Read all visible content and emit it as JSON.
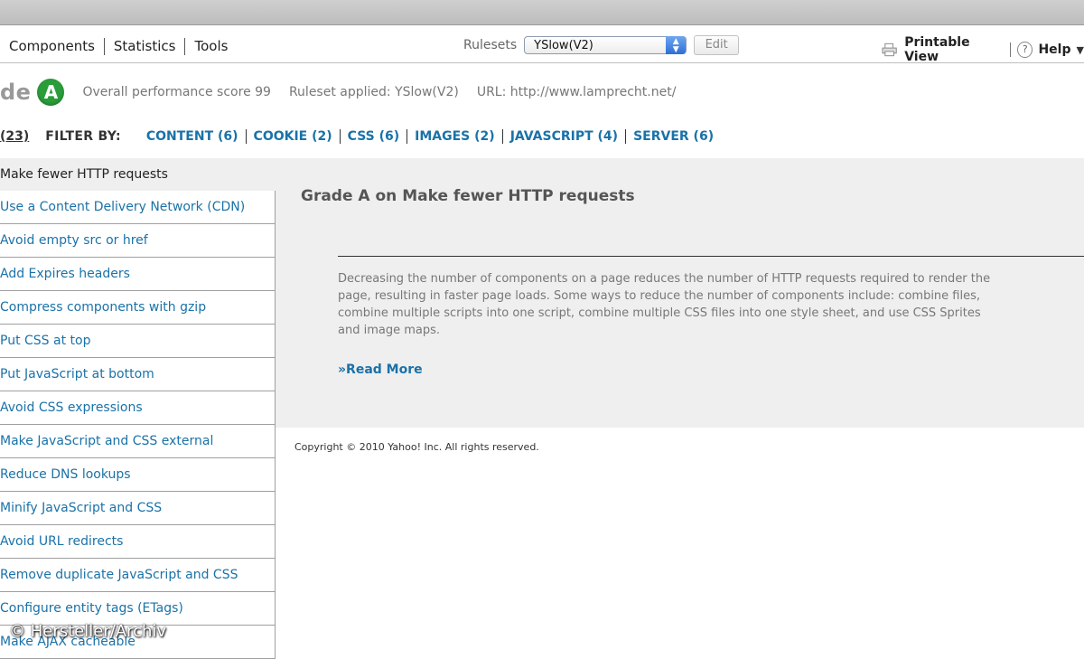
{
  "nav": {
    "tabs": [
      "Components",
      "Statistics",
      "Tools"
    ],
    "rulesets_label": "Rulesets",
    "ruleset_selected": "YSlow(V2)",
    "edit_label": "Edit",
    "printable_view": "Printable View",
    "help": "Help"
  },
  "grade": {
    "word": "de",
    "letter": "A",
    "score_text": "Overall performance score 99",
    "ruleset_text": "Ruleset applied: YSlow(V2)",
    "url_text": "URL: http://www.lamprecht.net/"
  },
  "filter": {
    "count": "(23)",
    "label": "FILTER BY:",
    "links": [
      "CONTENT (6)",
      "COOKIE (2)",
      "CSS (6)",
      "IMAGES (2)",
      "JAVASCRIPT (4)",
      "SERVER (6)"
    ]
  },
  "sidebar": {
    "items": [
      "Make fewer HTTP requests",
      "Use a Content Delivery Network (CDN)",
      "Avoid empty src or href",
      "Add Expires headers",
      "Compress components with gzip",
      "Put CSS at top",
      "Put JavaScript at bottom",
      "Avoid CSS expressions",
      "Make JavaScript and CSS external",
      "Reduce DNS lookups",
      "Minify JavaScript and CSS",
      "Avoid URL redirects",
      "Remove duplicate JavaScript and CSS",
      "Configure entity tags (ETags)",
      "Make AJAX cacheable"
    ]
  },
  "detail": {
    "title": "Grade A on Make fewer HTTP requests",
    "lines": [
      "Decreasing the number of components on a page reduces the number of HTTP requests required to render the",
      "page, resulting in faster page loads. Some ways to reduce the number of components include: combine files,",
      "combine multiple scripts into one script, combine multiple CSS files into one style sheet, and use CSS Sprites",
      "and image maps."
    ],
    "read_more": "»Read More"
  },
  "footer": {
    "copyright": "Copyright © 2010 Yahoo! Inc. All rights reserved."
  },
  "watermark": "© Hersteller/Archiv",
  "colors": {
    "link": "#1a72a8",
    "grade_green": "#2a9d3a",
    "panel_gray": "#efefef"
  }
}
